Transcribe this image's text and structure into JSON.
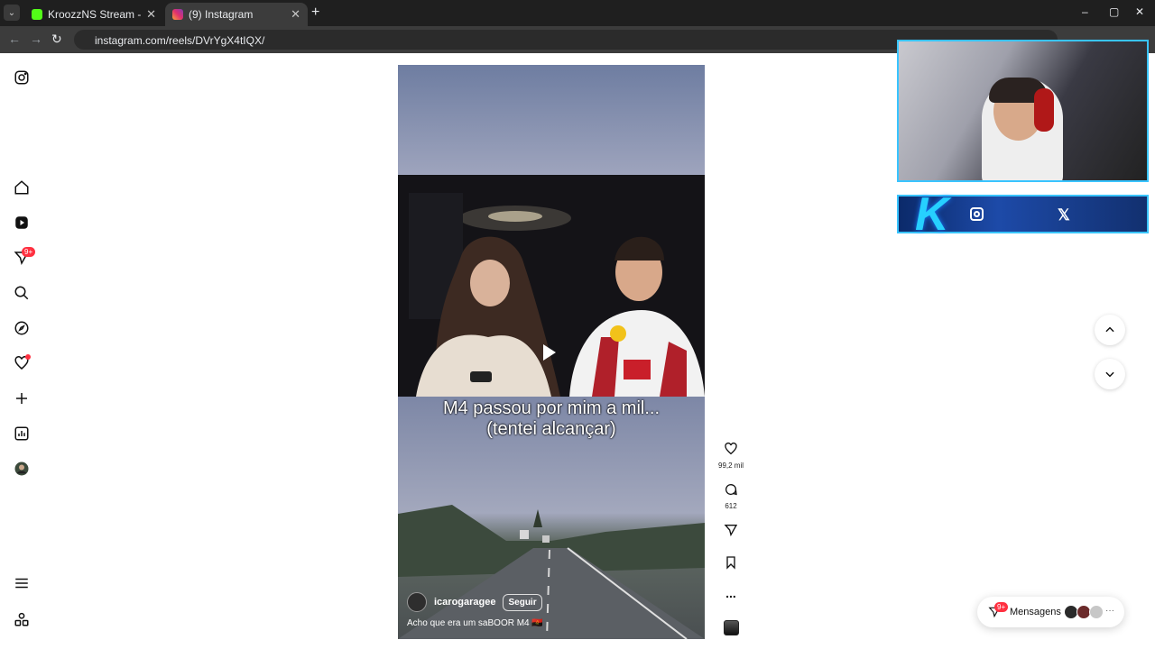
{
  "browser": {
    "tabs": [
      {
        "title": "KroozzNS Stream - Watch Live",
        "close": "✕"
      },
      {
        "title": "(9) Instagram",
        "close": "✕"
      }
    ],
    "new_tab": "+",
    "url": "instagram.com/reels/DVrYgX4tIQX/",
    "window_controls": [
      "–",
      "▢",
      "✕"
    ]
  },
  "sidebar": {
    "notifications_badge": "9+",
    "icons": [
      "instagram-logo-icon",
      "home-icon",
      "reels-icon",
      "messages-icon",
      "search-icon",
      "explore-icon",
      "notifications-icon",
      "create-icon",
      "dashboard-icon",
      "profile-avatar",
      "menu-icon",
      "more-apps-icon"
    ]
  },
  "reel": {
    "overlay_text_line1": "M4 passou por mim a mil...",
    "overlay_text_line2": "(tentei alcançar)",
    "username": "icarogaragee",
    "follow_label": "Seguir",
    "caption": "Acho que era um saBOOR M4 🇦🇴"
  },
  "actions": {
    "likes": "99,2 mil",
    "comments": "612",
    "more": "..."
  },
  "messages": {
    "label": "Mensagens",
    "badge": "9+",
    "more": "···"
  },
  "colors": {
    "instagram_red": "#ff3040",
    "overlay_accent": "#39c4ff"
  }
}
